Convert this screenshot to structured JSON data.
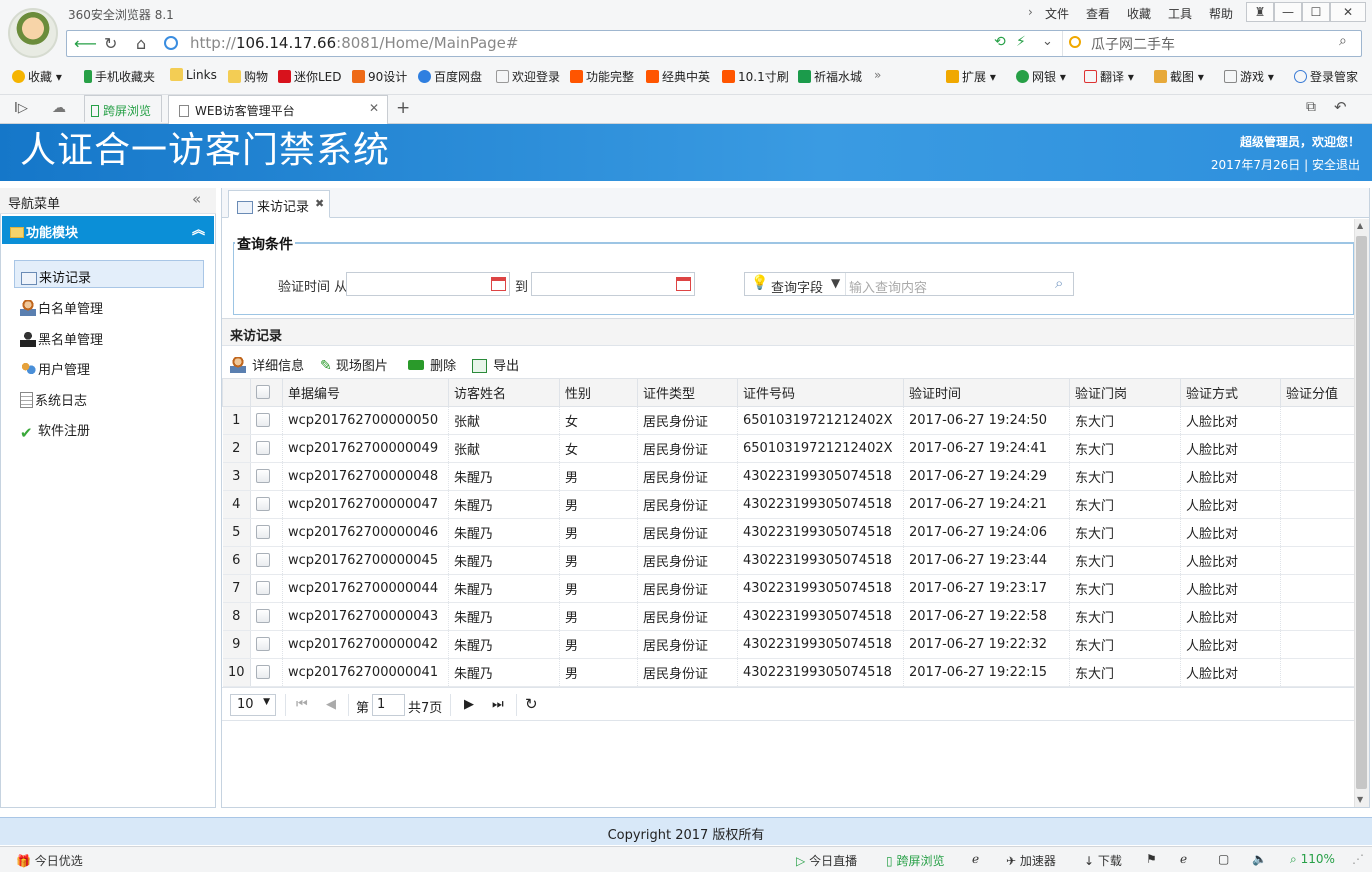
{
  "browser": {
    "app_name": "360安全浏览器 8.1",
    "menus": [
      "文件",
      "查看",
      "收藏",
      "工具",
      "帮助"
    ],
    "url_prefix": "http://",
    "url_host": "106.14.17.66",
    "url_rest": ":8081/Home/MainPage#",
    "search_placeholder": "瓜子网二手车",
    "favorites": [
      "收藏",
      "手机收藏夹",
      "Links",
      "购物",
      "迷你LED",
      "90设计",
      "百度网盘",
      "欢迎登录",
      "功能完整",
      "经典中英",
      "10.1寸刷",
      "祈福水城"
    ],
    "fav_right": [
      "扩展",
      "网银",
      "翻译",
      "截图",
      "游戏",
      "登录管家"
    ],
    "tabs": {
      "cross_screen": "跨屏浏览",
      "page_tab": "WEB访客管理平台"
    }
  },
  "header": {
    "title": "人证合一访客门禁系统",
    "welcome": "超级管理员，欢迎您！",
    "date": "2017年7月26日",
    "separator": "|",
    "logout": "安全退出"
  },
  "sidebar": {
    "title": "导航菜单",
    "module": "功能模块",
    "items": [
      {
        "label": "来访记录",
        "icon": "mail-icon"
      },
      {
        "label": "白名单管理",
        "icon": "user-icon"
      },
      {
        "label": "黑名单管理",
        "icon": "user-black-icon"
      },
      {
        "label": "用户管理",
        "icon": "users-icon"
      },
      {
        "label": "系统日志",
        "icon": "log-icon"
      },
      {
        "label": "软件注册",
        "icon": "check-icon"
      }
    ]
  },
  "main": {
    "tab": "来访记录",
    "query": {
      "legend": "查询条件",
      "date_label": "验证时间 从",
      "to_label": "到",
      "field_select": "查询字段",
      "field_placeholder": "输入查询内容"
    },
    "grid_title": "来访记录",
    "toolbar": {
      "detail": "详细信息",
      "photo": "现场图片",
      "delete": "删除",
      "export": "导出"
    },
    "columns": [
      "单据编号",
      "访客姓名",
      "性别",
      "证件类型",
      "证件号码",
      "验证时间",
      "验证门岗",
      "验证方式",
      "验证分值"
    ],
    "rows": [
      {
        "n": "1",
        "id": "wcp201762700000050",
        "name": "张献",
        "sex": "女",
        "type": "居民身份证",
        "card": "65010319721212402X",
        "time": "2017-06-27 19:24:50",
        "gate": "东大门",
        "method": "人脸比对",
        "score": ""
      },
      {
        "n": "2",
        "id": "wcp201762700000049",
        "name": "张献",
        "sex": "女",
        "type": "居民身份证",
        "card": "65010319721212402X",
        "time": "2017-06-27 19:24:41",
        "gate": "东大门",
        "method": "人脸比对",
        "score": ""
      },
      {
        "n": "3",
        "id": "wcp201762700000048",
        "name": "朱醒乃",
        "sex": "男",
        "type": "居民身份证",
        "card": "430223199305074518",
        "time": "2017-06-27 19:24:29",
        "gate": "东大门",
        "method": "人脸比对",
        "score": ""
      },
      {
        "n": "4",
        "id": "wcp201762700000047",
        "name": "朱醒乃",
        "sex": "男",
        "type": "居民身份证",
        "card": "430223199305074518",
        "time": "2017-06-27 19:24:21",
        "gate": "东大门",
        "method": "人脸比对",
        "score": ""
      },
      {
        "n": "5",
        "id": "wcp201762700000046",
        "name": "朱醒乃",
        "sex": "男",
        "type": "居民身份证",
        "card": "430223199305074518",
        "time": "2017-06-27 19:24:06",
        "gate": "东大门",
        "method": "人脸比对",
        "score": ""
      },
      {
        "n": "6",
        "id": "wcp201762700000045",
        "name": "朱醒乃",
        "sex": "男",
        "type": "居民身份证",
        "card": "430223199305074518",
        "time": "2017-06-27 19:23:44",
        "gate": "东大门",
        "method": "人脸比对",
        "score": ""
      },
      {
        "n": "7",
        "id": "wcp201762700000044",
        "name": "朱醒乃",
        "sex": "男",
        "type": "居民身份证",
        "card": "430223199305074518",
        "time": "2017-06-27 19:23:17",
        "gate": "东大门",
        "method": "人脸比对",
        "score": ""
      },
      {
        "n": "8",
        "id": "wcp201762700000043",
        "name": "朱醒乃",
        "sex": "男",
        "type": "居民身份证",
        "card": "430223199305074518",
        "time": "2017-06-27 19:22:58",
        "gate": "东大门",
        "method": "人脸比对",
        "score": ""
      },
      {
        "n": "9",
        "id": "wcp201762700000042",
        "name": "朱醒乃",
        "sex": "男",
        "type": "居民身份证",
        "card": "430223199305074518",
        "time": "2017-06-27 19:22:32",
        "gate": "东大门",
        "method": "人脸比对",
        "score": ""
      },
      {
        "n": "10",
        "id": "wcp201762700000041",
        "name": "朱醒乃",
        "sex": "男",
        "type": "居民身份证",
        "card": "430223199305074518",
        "time": "2017-06-27 19:22:15",
        "gate": "东大门",
        "method": "人脸比对",
        "score": ""
      }
    ],
    "pager": {
      "page_size": "10",
      "page_label": "第",
      "page_value": "1",
      "total_label": "共7页"
    }
  },
  "footer": "Copyright 2017 版权所有",
  "statusbar": {
    "left": "今日优选",
    "live": "今日直播",
    "cross": "跨屏浏览",
    "accel": "加速器",
    "download": "下载",
    "zoom": "110%"
  },
  "colors": {
    "header_blue": "#1577c9",
    "module_blue": "#0b8fd7",
    "footer_bg": "#d8e8f8",
    "brand_green": "#27a047"
  }
}
